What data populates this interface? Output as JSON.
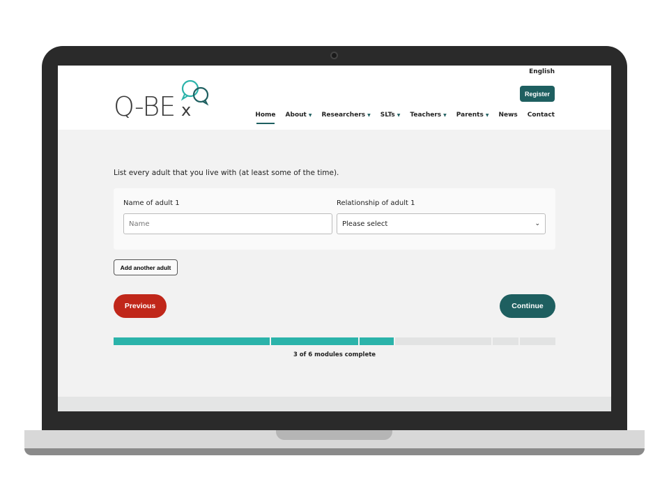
{
  "header": {
    "language": "English",
    "register_label": "Register",
    "logo_text": "Q-BEx",
    "nav": [
      {
        "label": "Home",
        "active": true
      },
      {
        "label": "About",
        "dropdown": true
      },
      {
        "label": "Researchers",
        "dropdown": true
      },
      {
        "label": "SLTs",
        "dropdown": true
      },
      {
        "label": "Teachers",
        "dropdown": true
      },
      {
        "label": "Parents",
        "dropdown": true
      },
      {
        "label": "News"
      },
      {
        "label": "Contact"
      }
    ]
  },
  "form": {
    "question": "List every adult that you live with (at least some of the time).",
    "name_label": "Name of adult 1",
    "name_placeholder": "Name",
    "name_value": "",
    "relationship_label": "Relationship of adult 1",
    "relationship_value": "Please select",
    "add_label": "Add another adult",
    "previous_label": "Previous",
    "continue_label": "Continue"
  },
  "progress": {
    "text": "3 of 6 modules complete",
    "completed": 3,
    "total": 6,
    "complete_color": "#2bb3aa",
    "incomplete_color": "#e2e3e3"
  },
  "colors": {
    "brand": "#1e5f60",
    "previous": "#c0271a"
  }
}
